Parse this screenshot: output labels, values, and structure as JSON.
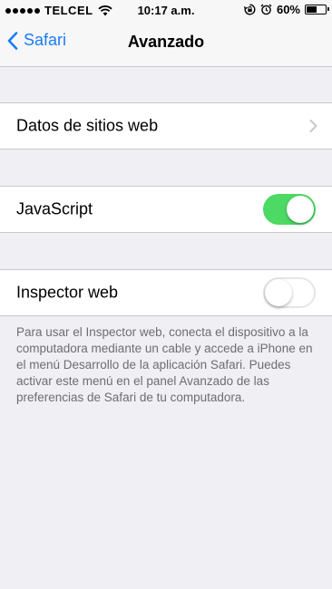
{
  "status_bar": {
    "carrier": "TELCEL",
    "time": "10:17 a.m.",
    "battery_percent_label": "60%",
    "battery_level": 0.6,
    "signal_icon": "signal-dots-icon",
    "wifi_icon": "wifi-icon",
    "rotation_lock_icon": "rotation-lock-icon",
    "alarm_icon": "alarm-icon"
  },
  "nav": {
    "back_label": "Safari",
    "title": "Avanzado",
    "accent_color": "#1a7cf5"
  },
  "settings": {
    "website_data_label": "Datos de sitios web",
    "javascript_label": "JavaScript",
    "javascript_enabled": true,
    "inspector_label": "Inspector web",
    "inspector_enabled": false,
    "toggle_on_color": "#4cd964"
  },
  "footer": {
    "note": "Para usar el Inspector web, conecta el dispositivo a la computadora mediante un cable y accede a iPhone en el menú Desarrollo de la aplicación Safari. Puedes activar este menú en el panel Avanzado de las preferencias de Safari de tu computadora."
  }
}
